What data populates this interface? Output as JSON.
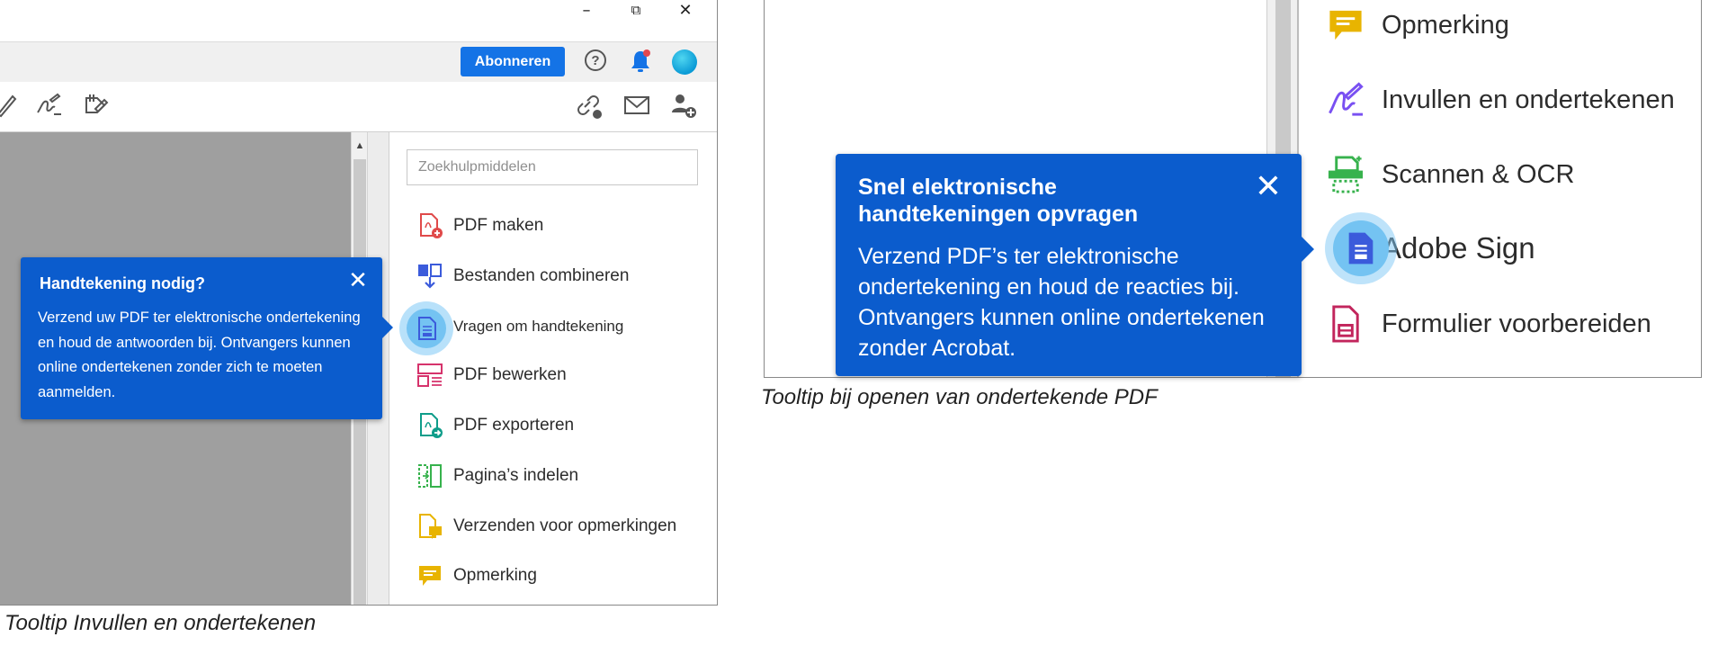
{
  "left": {
    "window_controls": {
      "minimize": "–",
      "restore": "⧉",
      "close": "✕"
    },
    "toolbar": {
      "subscribe_label": "Abonneren",
      "help_label": "?"
    },
    "search": {
      "placeholder": "Zoekhulpmiddelen"
    },
    "tools": [
      {
        "name": "pdf-maken",
        "label": "PDF maken",
        "icon": "create-pdf-icon",
        "color": "#e04a4a"
      },
      {
        "name": "bestanden-combineren",
        "label": "Bestanden combineren",
        "icon": "combine-files-icon",
        "color": "#3b5bdb"
      },
      {
        "name": "vragen-om-handtekening",
        "label": "Vragen om handtekening",
        "icon": "request-signature-icon",
        "color": "#3b5bdb"
      },
      {
        "name": "pdf-bewerken",
        "label": "PDF bewerken",
        "icon": "edit-pdf-icon",
        "color": "#d6336c"
      },
      {
        "name": "pdf-exporteren",
        "label": "PDF exporteren",
        "icon": "export-pdf-icon",
        "color": "#0f9d8a"
      },
      {
        "name": "paginas-indelen",
        "label": "Pagina’s indelen",
        "icon": "organize-pages-icon",
        "color": "#37b24d"
      },
      {
        "name": "verzenden-voor-opmerkingen",
        "label": "Verzenden voor opmerkingen",
        "icon": "send-for-comments-icon",
        "color": "#e8b400"
      },
      {
        "name": "opmerking",
        "label": "Opmerking",
        "icon": "comment-icon",
        "color": "#e8b400"
      }
    ],
    "tooltip": {
      "title": "Handtekening nodig?",
      "body": "Verzend uw PDF ter elektronische ondertekening en houd de antwoorden bij. Ontvangers kunnen online ondertekenen zonder zich te moeten aanmelden.",
      "close": "✕"
    },
    "caption": "Tooltip Invullen en ondertekenen"
  },
  "right": {
    "tools": [
      {
        "name": "opmerking",
        "label": "Opmerking",
        "icon": "comment-icon",
        "color": "#e8b400"
      },
      {
        "name": "invullen-en-ondertekenen",
        "label": "Invullen en ondertekenen",
        "icon": "fill-and-sign-icon",
        "color": "#7950f2"
      },
      {
        "name": "scannen-ocr",
        "label": "Scannen & OCR",
        "icon": "scan-ocr-icon",
        "color": "#37b24d"
      },
      {
        "name": "adobe-sign",
        "label": "Adobe Sign",
        "icon": "adobe-sign-icon",
        "color": "#3b5bdb"
      },
      {
        "name": "formulier-voorbereiden",
        "label": "Formulier voorbereiden",
        "icon": "prepare-form-icon",
        "color": "#c2255c"
      }
    ],
    "tooltip": {
      "title": "Snel elektronische handtekeningen opvragen",
      "body": "Verzend PDF’s ter elektronische ondertekening en houd de reacties bij. Ontvangers kunnen online ondertekenen zonder Acrobat.",
      "close": "✕"
    },
    "caption": "Tooltip bij openen van ondertekende PDF"
  },
  "colors": {
    "accent": "#1473e6",
    "tooltip_bg": "#0b5ccd",
    "highlight": "#74c3f2"
  }
}
